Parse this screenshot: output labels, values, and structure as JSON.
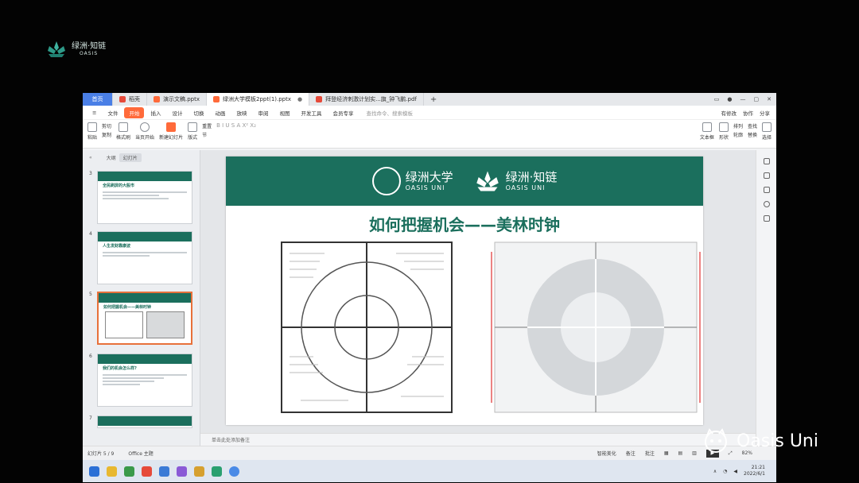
{
  "brand": {
    "name_cn": "绿洲·知链",
    "name_en": "OASIS"
  },
  "tabs": [
    {
      "label": "首页",
      "kind": "home"
    },
    {
      "label": "稻壳",
      "color": "#e64a3a"
    },
    {
      "label": "演示文稿.pptx",
      "color": "#ff6a3a"
    },
    {
      "label": "绿洲大学模板2ppt(1).pptx",
      "color": "#ff6a3a",
      "active": true
    },
    {
      "label": "拜登经济刺激计划实...旗_钟飞鹏.pdf",
      "color": "#e64a3a"
    }
  ],
  "tab_plus": "+",
  "menu": {
    "file": "文件",
    "items": [
      "开始",
      "插入",
      "设计",
      "切换",
      "动画",
      "放映",
      "审阅",
      "视图",
      "开发工具",
      "会员专享"
    ],
    "active": "开始",
    "search": "查找命令、搜索模板",
    "right": [
      "有修改",
      "协作",
      "分享"
    ]
  },
  "ribbon": {
    "groups": [
      "粘贴",
      "格式刷",
      "当页开始",
      "新建幻灯片",
      "版式",
      "节"
    ],
    "small": [
      [
        "剪切",
        "复制"
      ],
      [
        "重置"
      ]
    ],
    "right": [
      "文本框",
      "形状",
      "排列",
      "轮廓",
      "查找",
      "替换",
      "选择"
    ],
    "fmt": "B I U S A X² X₂"
  },
  "left_panel": {
    "view_tabs": [
      "大纲",
      "幻灯片"
    ],
    "active_view": "幻灯片",
    "slides": [
      {
        "num": "3",
        "title": "全民刷屏的大股市"
      },
      {
        "num": "4",
        "title": "人生发财靠康波"
      },
      {
        "num": "5",
        "title": "如何把握机会——美林时钟"
      },
      {
        "num": "6",
        "title": "我们的机会怎么样?"
      },
      {
        "num": "7",
        "title": ""
      }
    ],
    "add": "+"
  },
  "slide": {
    "logo1_cn": "绿洲大学",
    "logo1_en": "OASIS UNI",
    "logo2_cn": "绿洲·知链",
    "logo2_en": "OASIS UNI",
    "title": "如何把握机会——美林时钟"
  },
  "notes": "单击此处添加备注",
  "status": {
    "slide_info": "幻灯片 5 / 9",
    "theme": "Office 主题",
    "items": [
      "智能美化",
      "备注",
      "批注"
    ],
    "zoom": "82%"
  },
  "taskbar": {
    "time": "21:21",
    "date": "2022/6/1"
  },
  "watermark": "Oasis Uni"
}
